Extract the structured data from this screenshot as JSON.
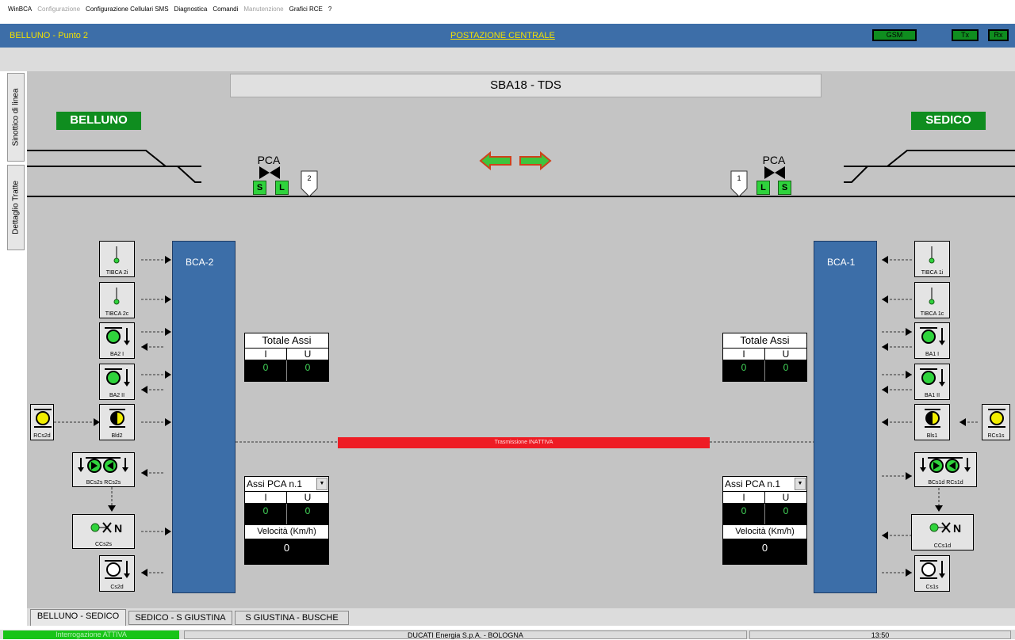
{
  "menu": [
    "WinBCA",
    "Configurazione",
    "Configurazione Cellulari SMS",
    "Diagnostica",
    "Comandi",
    "Manutenzione",
    "Grafici RCE",
    "?"
  ],
  "menu_disabled": [
    1,
    5
  ],
  "header": {
    "location": "BELLUNO - Punto 2",
    "title": "POSTAZIONE CENTRALE",
    "gsm": "GSM",
    "tx": "Tx",
    "rx": "Rx"
  },
  "side_tabs": [
    "Sinottico di linea",
    "Dettaglio Tratte"
  ],
  "screen_title": "SBA18 - TDS",
  "stations": {
    "left": "BELLUNO",
    "right": "SEDICO"
  },
  "pca_left": {
    "label": "PCA",
    "s": "S",
    "l": "L",
    "num": "2"
  },
  "pca_right": {
    "label": "PCA",
    "s": "S",
    "l": "L",
    "num": "1"
  },
  "bca_left": "BCA-2",
  "bca_right": "BCA-1",
  "left_devices": {
    "tibca_2i": "TIBCA 2i",
    "tibca_2c": "TIBCA 2c",
    "ba2_i": "BA2 I",
    "ba2_ii": "BA2 II",
    "bld2": "Bld2",
    "rcs2d": "RCs2d",
    "bcs2s": "BCs2s  RCs2s",
    "ccs2s": "CCs2s",
    "cs2d": "Cs2d"
  },
  "right_devices": {
    "tibca_1i": "TIBCA 1i",
    "tibca_1c": "TIBCA 1c",
    "ba1_i": "BA1 I",
    "ba1_ii": "BA1 II",
    "bls1": "Bls1",
    "rcs1s": "RCs1s",
    "bcs1d": "BCs1d  RCs1d",
    "ccs1d": "CCs1d",
    "cs1s": "Cs1s"
  },
  "totale_assi_left": {
    "title": "Totale Assi",
    "i": "I",
    "u": "U",
    "i_val": "0",
    "u_val": "0"
  },
  "totale_assi_right": {
    "title": "Totale Assi",
    "i": "I",
    "u": "U",
    "i_val": "0",
    "u_val": "0"
  },
  "assi_pca_left": {
    "select": "Assi PCA n.1",
    "i": "I",
    "u": "U",
    "i_val": "0",
    "u_val": "0",
    "speed_label": "Velocità (Km/h)",
    "speed": "0"
  },
  "assi_pca_right": {
    "select": "Assi PCA n.1",
    "i": "I",
    "u": "U",
    "i_val": "0",
    "u_val": "0",
    "speed_label": "Velocità (Km/h)",
    "speed": "0"
  },
  "transmission": "Trasmissione INATTIVA",
  "bottom_tabs": [
    "BELLUNO - SEDICO",
    "SEDICO - S GIUSTINA",
    "S GIUSTINA - BUSCHE"
  ],
  "status": {
    "interrogation": "Interrogazione ATTIVA",
    "company": "DUCATI Energia S.p.A.  -  BOLOGNA",
    "time": "13:50"
  },
  "colors": {
    "title_bg": "#3d6ea8",
    "accent_yellow": "#f2e000",
    "station_green": "#0f8d1f",
    "bca_blue": "#3c6ea8",
    "signal_green": "#2fd33c",
    "signal_yellow": "#f2ee00",
    "transmission_red": "#ee1c24"
  }
}
